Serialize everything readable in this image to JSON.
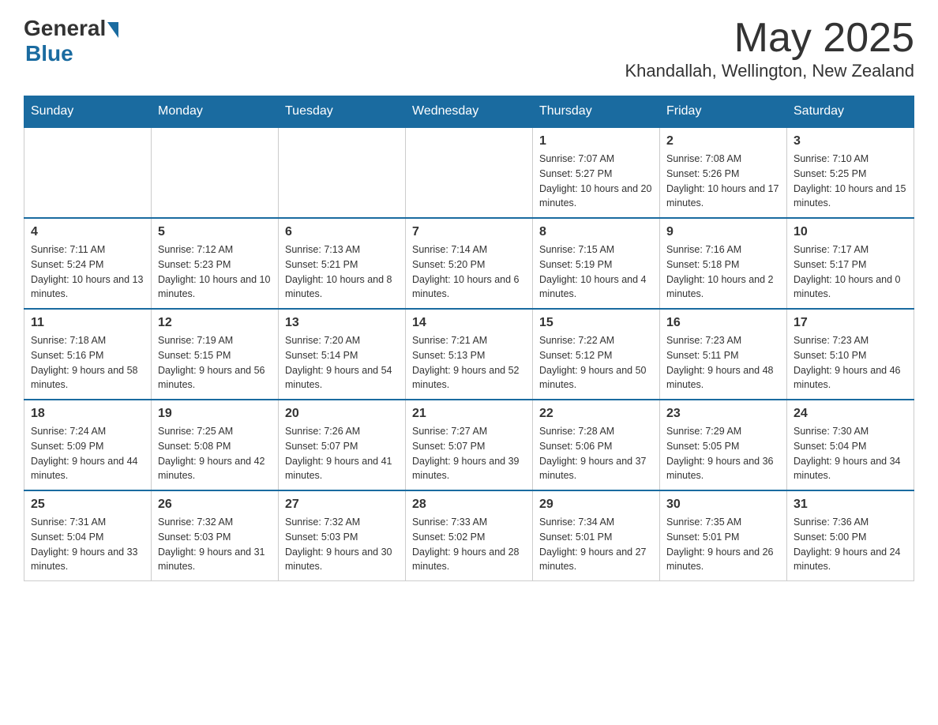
{
  "header": {
    "logo_general": "General",
    "logo_blue": "Blue",
    "month_title": "May 2025",
    "location": "Khandallah, Wellington, New Zealand"
  },
  "weekdays": [
    "Sunday",
    "Monday",
    "Tuesday",
    "Wednesday",
    "Thursday",
    "Friday",
    "Saturday"
  ],
  "weeks": [
    [
      {
        "day": "",
        "info": ""
      },
      {
        "day": "",
        "info": ""
      },
      {
        "day": "",
        "info": ""
      },
      {
        "day": "",
        "info": ""
      },
      {
        "day": "1",
        "info": "Sunrise: 7:07 AM\nSunset: 5:27 PM\nDaylight: 10 hours and 20 minutes."
      },
      {
        "day": "2",
        "info": "Sunrise: 7:08 AM\nSunset: 5:26 PM\nDaylight: 10 hours and 17 minutes."
      },
      {
        "day": "3",
        "info": "Sunrise: 7:10 AM\nSunset: 5:25 PM\nDaylight: 10 hours and 15 minutes."
      }
    ],
    [
      {
        "day": "4",
        "info": "Sunrise: 7:11 AM\nSunset: 5:24 PM\nDaylight: 10 hours and 13 minutes."
      },
      {
        "day": "5",
        "info": "Sunrise: 7:12 AM\nSunset: 5:23 PM\nDaylight: 10 hours and 10 minutes."
      },
      {
        "day": "6",
        "info": "Sunrise: 7:13 AM\nSunset: 5:21 PM\nDaylight: 10 hours and 8 minutes."
      },
      {
        "day": "7",
        "info": "Sunrise: 7:14 AM\nSunset: 5:20 PM\nDaylight: 10 hours and 6 minutes."
      },
      {
        "day": "8",
        "info": "Sunrise: 7:15 AM\nSunset: 5:19 PM\nDaylight: 10 hours and 4 minutes."
      },
      {
        "day": "9",
        "info": "Sunrise: 7:16 AM\nSunset: 5:18 PM\nDaylight: 10 hours and 2 minutes."
      },
      {
        "day": "10",
        "info": "Sunrise: 7:17 AM\nSunset: 5:17 PM\nDaylight: 10 hours and 0 minutes."
      }
    ],
    [
      {
        "day": "11",
        "info": "Sunrise: 7:18 AM\nSunset: 5:16 PM\nDaylight: 9 hours and 58 minutes."
      },
      {
        "day": "12",
        "info": "Sunrise: 7:19 AM\nSunset: 5:15 PM\nDaylight: 9 hours and 56 minutes."
      },
      {
        "day": "13",
        "info": "Sunrise: 7:20 AM\nSunset: 5:14 PM\nDaylight: 9 hours and 54 minutes."
      },
      {
        "day": "14",
        "info": "Sunrise: 7:21 AM\nSunset: 5:13 PM\nDaylight: 9 hours and 52 minutes."
      },
      {
        "day": "15",
        "info": "Sunrise: 7:22 AM\nSunset: 5:12 PM\nDaylight: 9 hours and 50 minutes."
      },
      {
        "day": "16",
        "info": "Sunrise: 7:23 AM\nSunset: 5:11 PM\nDaylight: 9 hours and 48 minutes."
      },
      {
        "day": "17",
        "info": "Sunrise: 7:23 AM\nSunset: 5:10 PM\nDaylight: 9 hours and 46 minutes."
      }
    ],
    [
      {
        "day": "18",
        "info": "Sunrise: 7:24 AM\nSunset: 5:09 PM\nDaylight: 9 hours and 44 minutes."
      },
      {
        "day": "19",
        "info": "Sunrise: 7:25 AM\nSunset: 5:08 PM\nDaylight: 9 hours and 42 minutes."
      },
      {
        "day": "20",
        "info": "Sunrise: 7:26 AM\nSunset: 5:07 PM\nDaylight: 9 hours and 41 minutes."
      },
      {
        "day": "21",
        "info": "Sunrise: 7:27 AM\nSunset: 5:07 PM\nDaylight: 9 hours and 39 minutes."
      },
      {
        "day": "22",
        "info": "Sunrise: 7:28 AM\nSunset: 5:06 PM\nDaylight: 9 hours and 37 minutes."
      },
      {
        "day": "23",
        "info": "Sunrise: 7:29 AM\nSunset: 5:05 PM\nDaylight: 9 hours and 36 minutes."
      },
      {
        "day": "24",
        "info": "Sunrise: 7:30 AM\nSunset: 5:04 PM\nDaylight: 9 hours and 34 minutes."
      }
    ],
    [
      {
        "day": "25",
        "info": "Sunrise: 7:31 AM\nSunset: 5:04 PM\nDaylight: 9 hours and 33 minutes."
      },
      {
        "day": "26",
        "info": "Sunrise: 7:32 AM\nSunset: 5:03 PM\nDaylight: 9 hours and 31 minutes."
      },
      {
        "day": "27",
        "info": "Sunrise: 7:32 AM\nSunset: 5:03 PM\nDaylight: 9 hours and 30 minutes."
      },
      {
        "day": "28",
        "info": "Sunrise: 7:33 AM\nSunset: 5:02 PM\nDaylight: 9 hours and 28 minutes."
      },
      {
        "day": "29",
        "info": "Sunrise: 7:34 AM\nSunset: 5:01 PM\nDaylight: 9 hours and 27 minutes."
      },
      {
        "day": "30",
        "info": "Sunrise: 7:35 AM\nSunset: 5:01 PM\nDaylight: 9 hours and 26 minutes."
      },
      {
        "day": "31",
        "info": "Sunrise: 7:36 AM\nSunset: 5:00 PM\nDaylight: 9 hours and 24 minutes."
      }
    ]
  ]
}
